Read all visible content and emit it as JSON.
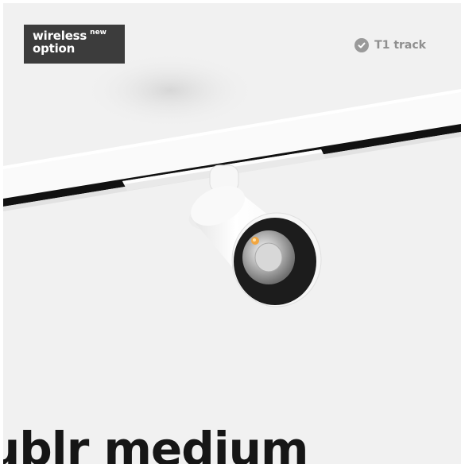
{
  "badge": {
    "word": "wireless",
    "superscript": "new",
    "line2": "option"
  },
  "track_tag": {
    "icon": "check-circle-icon",
    "label": "T1 track"
  },
  "product": {
    "title": "ublr medium"
  },
  "colors": {
    "background": "#f1f1f1",
    "badge_background": "#3c3c3c",
    "tag_text": "#8f8f8f",
    "title_text": "#161616",
    "led_accent": "#f2a640"
  }
}
